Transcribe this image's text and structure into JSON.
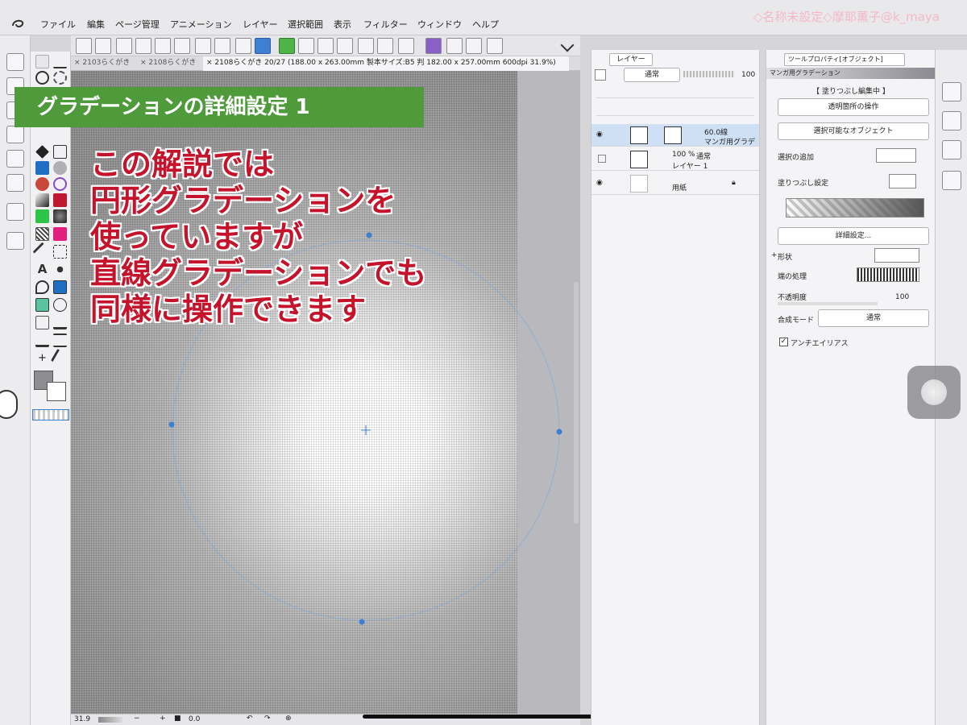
{
  "menubar": {
    "items": [
      "ファイル",
      "編集",
      "ページ管理",
      "アニメーション",
      "レイヤー",
      "選択範囲",
      "表示",
      "フィルター",
      "ウィンドウ",
      "ヘルプ"
    ],
    "watermark": "◇名称未設定◇摩耶薫子@k_maya"
  },
  "tabs": {
    "items": [
      "2103らくがき",
      "2108らくがき"
    ],
    "current": "2108らくがき 20/27 (188.00 x 263.00mm 製本サイズ:B5 判 182.00 x 257.00mm 600dpi 31.9%)"
  },
  "overlay": {
    "title": "グラデーションの詳細設定 1",
    "explanation_lines": [
      "この解説では",
      "円形グラデーションを",
      "使っていますが",
      "直線グラデーションでも",
      "同様に操作できます"
    ]
  },
  "layer_panel": {
    "tab_label": "レイヤー",
    "blend_mode": "通常",
    "opacity": "100",
    "layers": [
      {
        "percent": "60.0線",
        "name": "マンガ用グラデ"
      },
      {
        "percent": "100 %",
        "mode": "通常",
        "name": "レイヤー 1"
      },
      {
        "name": "用紙"
      }
    ]
  },
  "tool_property": {
    "tab_label": "ツールプロパティ[オブジェクト]",
    "tool_name": "マンガ用グラデーション",
    "editing_label": "【 塗りつぶし編集中 】",
    "transparent_dropdown": "透明箇所の操作",
    "selectable_object_dropdown": "選択可能なオブジェクト",
    "selection_add_label": "選択の追加",
    "fill_setting_label": "塗りつぶし設定",
    "detail_button": "詳細設定...",
    "shape_label": "形状",
    "edge_label": "端の処理",
    "opacity_label": "不透明度",
    "opacity_value": "100",
    "blend_label": "合成モード",
    "blend_value": "通常",
    "antialias_label": "アンチエイリアス"
  },
  "status_bar": {
    "zoom": "31.9",
    "rotation": "0.0"
  },
  "colors": {
    "banner": "#4f9a3b",
    "explanation_text": "#c4132b",
    "watermark": "#f3b8c8",
    "selection_highlight": "#cfe0f4"
  }
}
